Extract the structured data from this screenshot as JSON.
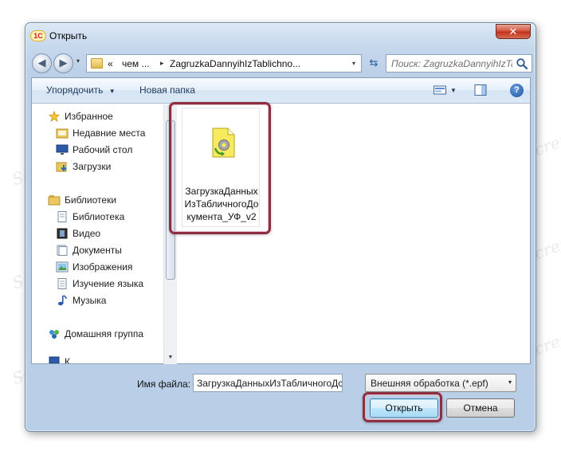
{
  "window": {
    "app_icon_text": "1С",
    "title": "Открыть",
    "close_glyph": "✕"
  },
  "navbar": {
    "back_glyph": "◀",
    "forward_glyph": "▶",
    "history_glyph": "▾",
    "address_parts": [
      "«",
      "чем ...",
      "ZagruzkaDannyihIzTablichno..."
    ],
    "address_separator": "▸",
    "address_dropdown_glyph": "▾",
    "refresh_glyph": "⇆",
    "search_placeholder": "Поиск: ZagruzkaDannyihIzTa..."
  },
  "toolbar": {
    "organize_label": "Упорядочить",
    "organize_arrow": "▼",
    "new_folder_label": "Новая папка",
    "view_arrow": "▼",
    "help_glyph": "?"
  },
  "navpane": {
    "favorites_header": "Избранное",
    "favorites": [
      "Недавние места",
      "Рабочий стол",
      "Загрузки"
    ],
    "libraries_header": "Библиотеки",
    "libraries": [
      "Библиотека",
      "Видео",
      "Документы",
      "Изображения",
      "Изучение языка",
      "Музыка"
    ],
    "homegroup": "Домашняя группа",
    "partial_item": "К"
  },
  "scrollbar": {
    "up_glyph": "▲",
    "down_glyph": "▼"
  },
  "files": [
    {
      "name": "ЗагрузкаДанныхИзТабличногоДокумента_УФ_v2",
      "icon": "epf-file-icon"
    }
  ],
  "footer": {
    "filename_label": "Имя файла:",
    "filename_value": "ЗагрузкаДанныхИзТабличногоДс",
    "filter_value": "Внешняя обработка (*.epf)",
    "filter_arrow": "▾",
    "open_label": "Открыть",
    "cancel_label": "Отмена"
  },
  "watermark_text": "Soringpcrepair.com",
  "colors": {
    "highlight": "#8e2e43",
    "title_gradient_top": "#dbe8f6",
    "close_button": "#c0321a"
  }
}
